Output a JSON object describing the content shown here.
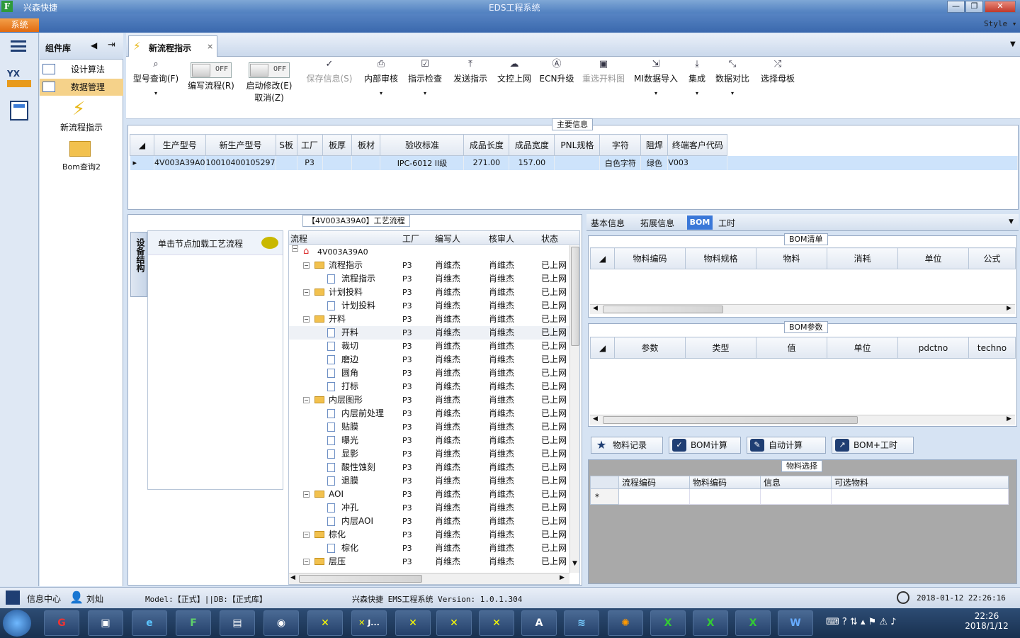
{
  "app": {
    "name": "兴森快捷",
    "title": "EDS工程系统",
    "style_label": "Style",
    "system_menu": "系统"
  },
  "sidebar": {
    "title": "组件库",
    "items": [
      {
        "label": "设计算法"
      },
      {
        "label": "数据管理"
      }
    ],
    "big_items": [
      {
        "label": "新流程指示"
      },
      {
        "label": "Bom查询2"
      }
    ]
  },
  "tab": {
    "label": "新流程指示"
  },
  "ribbon": {
    "buttons": [
      {
        "label": "型号查询(F)",
        "icon": "search-icon"
      },
      {
        "label": "编写流程(R)",
        "toggle": "OFF"
      },
      {
        "label": "启动修改(E)",
        "label2": "取消(Z)",
        "toggle": "OFF"
      },
      {
        "label": "保存信息(S)",
        "icon": "check-icon"
      },
      {
        "label": "内部审核",
        "icon": "print-icon"
      },
      {
        "label": "指示检查",
        "icon": "checkbox-icon"
      },
      {
        "label": "发送指示",
        "icon": "upload-icon"
      },
      {
        "label": "文控上网",
        "icon": "cloud-upload-icon"
      },
      {
        "label": "ECN升级",
        "icon": "ecn-icon"
      },
      {
        "label": "重选开料图",
        "icon": "image-icon"
      },
      {
        "label": "MI数据导入",
        "icon": "import-icon"
      },
      {
        "label": "集成",
        "icon": "download-icon"
      },
      {
        "label": "数据对比",
        "icon": "compare-icon"
      },
      {
        "label": "选择母板",
        "icon": "shuffle-icon"
      }
    ]
  },
  "main_info": {
    "title": "主要信息",
    "columns": [
      "生产型号",
      "新生产型号",
      "S板",
      "工厂",
      "板厚",
      "板材",
      "验收标准",
      "成品长度",
      "成品宽度",
      "PNL规格",
      "字符",
      "阻焊",
      "终端客户代码"
    ],
    "row": [
      "4V003A39A0",
      "10010400105297",
      "",
      "P3",
      "",
      "",
      "IPC-6012 II级",
      "271.00",
      "157.00",
      "",
      "白色字符",
      "绿色",
      "V003"
    ]
  },
  "process": {
    "title": "【4V003A39A0】工艺流程",
    "side_tab": "设备结构",
    "hint": "单击节点加载工艺流程",
    "columns": [
      "流程",
      "工厂",
      "编写人",
      "核审人",
      "状态"
    ],
    "root": "4V003A39A0",
    "rows": [
      {
        "label": "流程指示",
        "level": 1,
        "folder": true,
        "factory": "P3",
        "writer": "肖维杰",
        "reviewer": "肖维杰",
        "status": "已上网"
      },
      {
        "label": "流程指示",
        "level": 2,
        "folder": false,
        "factory": "P3",
        "writer": "肖维杰",
        "reviewer": "肖维杰",
        "status": "已上网"
      },
      {
        "label": "计划投料",
        "level": 1,
        "folder": true,
        "factory": "P3",
        "writer": "肖维杰",
        "reviewer": "肖维杰",
        "status": "已上网"
      },
      {
        "label": "计划投料",
        "level": 2,
        "folder": false,
        "factory": "P3",
        "writer": "肖维杰",
        "reviewer": "肖维杰",
        "status": "已上网"
      },
      {
        "label": "开料",
        "level": 1,
        "folder": true,
        "factory": "P3",
        "writer": "肖维杰",
        "reviewer": "肖维杰",
        "status": "已上网"
      },
      {
        "label": "开料",
        "level": 2,
        "folder": false,
        "factory": "P3",
        "writer": "肖维杰",
        "reviewer": "肖维杰",
        "status": "已上网"
      },
      {
        "label": "裁切",
        "level": 2,
        "folder": false,
        "factory": "P3",
        "writer": "肖维杰",
        "reviewer": "肖维杰",
        "status": "已上网"
      },
      {
        "label": "磨边",
        "level": 2,
        "folder": false,
        "factory": "P3",
        "writer": "肖维杰",
        "reviewer": "肖维杰",
        "status": "已上网"
      },
      {
        "label": "圆角",
        "level": 2,
        "folder": false,
        "factory": "P3",
        "writer": "肖维杰",
        "reviewer": "肖维杰",
        "status": "已上网"
      },
      {
        "label": "打标",
        "level": 2,
        "folder": false,
        "factory": "P3",
        "writer": "肖维杰",
        "reviewer": "肖维杰",
        "status": "已上网"
      },
      {
        "label": "内层图形",
        "level": 1,
        "folder": true,
        "factory": "P3",
        "writer": "肖维杰",
        "reviewer": "肖维杰",
        "status": "已上网"
      },
      {
        "label": "内层前处理",
        "level": 2,
        "folder": false,
        "factory": "P3",
        "writer": "肖维杰",
        "reviewer": "肖维杰",
        "status": "已上网"
      },
      {
        "label": "贴膜",
        "level": 2,
        "folder": false,
        "factory": "P3",
        "writer": "肖维杰",
        "reviewer": "肖维杰",
        "status": "已上网"
      },
      {
        "label": "曝光",
        "level": 2,
        "folder": false,
        "factory": "P3",
        "writer": "肖维杰",
        "reviewer": "肖维杰",
        "status": "已上网"
      },
      {
        "label": "显影",
        "level": 2,
        "folder": false,
        "factory": "P3",
        "writer": "肖维杰",
        "reviewer": "肖维杰",
        "status": "已上网"
      },
      {
        "label": "酸性蚀刻",
        "level": 2,
        "folder": false,
        "factory": "P3",
        "writer": "肖维杰",
        "reviewer": "肖维杰",
        "status": "已上网"
      },
      {
        "label": "退膜",
        "level": 2,
        "folder": false,
        "factory": "P3",
        "writer": "肖维杰",
        "reviewer": "肖维杰",
        "status": "已上网"
      },
      {
        "label": "AOI",
        "level": 1,
        "folder": true,
        "factory": "P3",
        "writer": "肖维杰",
        "reviewer": "肖维杰",
        "status": "已上网"
      },
      {
        "label": "冲孔",
        "level": 2,
        "folder": false,
        "factory": "P3",
        "writer": "肖维杰",
        "reviewer": "肖维杰",
        "status": "已上网"
      },
      {
        "label": "内层AOI",
        "level": 2,
        "folder": false,
        "factory": "P3",
        "writer": "肖维杰",
        "reviewer": "肖维杰",
        "status": "已上网"
      },
      {
        "label": "棕化",
        "level": 1,
        "folder": true,
        "factory": "P3",
        "writer": "肖维杰",
        "reviewer": "肖维杰",
        "status": "已上网"
      },
      {
        "label": "棕化",
        "level": 2,
        "folder": false,
        "factory": "P3",
        "writer": "肖维杰",
        "reviewer": "肖维杰",
        "status": "已上网"
      },
      {
        "label": "层压",
        "level": 1,
        "folder": true,
        "factory": "P3",
        "writer": "肖维杰",
        "reviewer": "肖维杰",
        "status": "已上网"
      }
    ]
  },
  "right": {
    "tabs": [
      "基本信息",
      "拓展信息",
      "BOM",
      "工时"
    ],
    "bom_list": {
      "title": "BOM清单",
      "columns": [
        "物料编码",
        "物料规格",
        "物料",
        "消耗",
        "单位",
        "公式"
      ]
    },
    "bom_params": {
      "title": "BOM参数",
      "columns": [
        "参数",
        "类型",
        "值",
        "单位",
        "pdctno",
        "techno"
      ]
    },
    "actions": [
      {
        "label": "物料记录",
        "icon": "star-icon"
      },
      {
        "label": "BOM计算",
        "icon": "check-icon"
      },
      {
        "label": "自动计算",
        "icon": "pencil-icon"
      },
      {
        "label": "BOM+工时",
        "icon": "arrow-icon"
      }
    ],
    "material": {
      "title": "物料选择",
      "columns": [
        "流程编码",
        "物料编码",
        "信息",
        "可选物料"
      ],
      "new_row_marker": "*"
    }
  },
  "status": {
    "info_center": "信息中心",
    "user": "刘灿",
    "model": "Model:【正式】||DB:【正式库】",
    "version": "兴森快捷 EMS工程系统 Version: 1.0.1.304",
    "datetime": "2018-01-12 22:26:16"
  },
  "taskbar": {
    "time": "22:26",
    "date": "2018/1/12",
    "app_short": "J..."
  }
}
